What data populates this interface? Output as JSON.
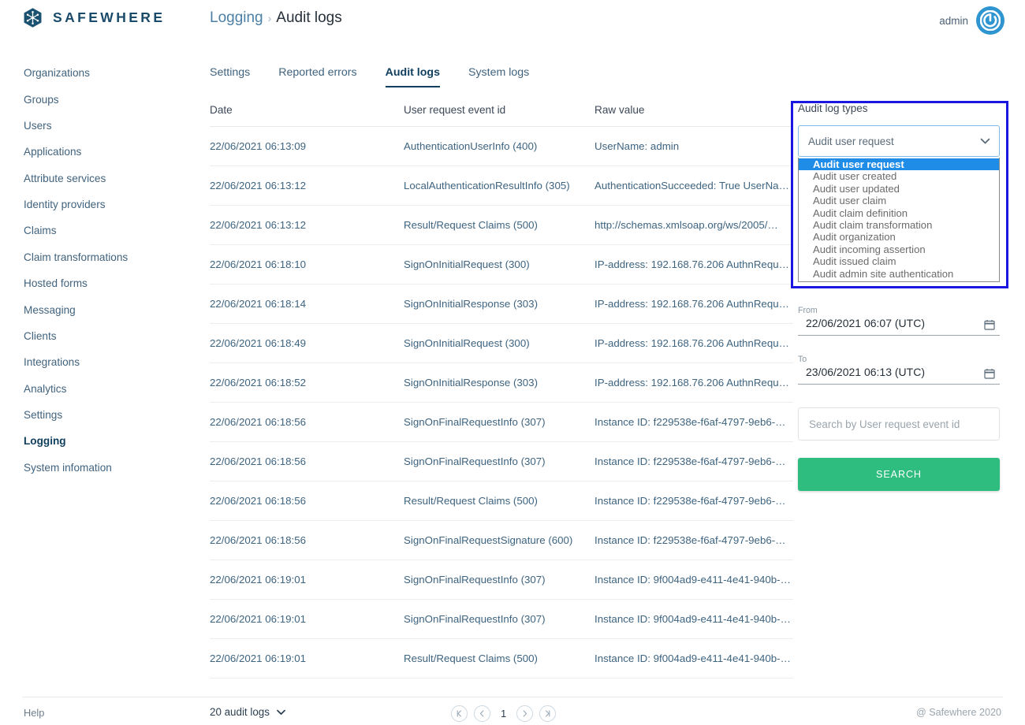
{
  "brand": {
    "name": "SAFEWHERE",
    "logo_icon": "snowflake-hex-logo"
  },
  "breadcrumb": {
    "parent": "Logging",
    "separator": "›",
    "current": "Audit logs"
  },
  "user": {
    "name": "admin",
    "avatar_icon": "power-icon"
  },
  "sidebar": {
    "items": [
      {
        "label": "Organizations",
        "active": false
      },
      {
        "label": "Groups",
        "active": false
      },
      {
        "label": "Users",
        "active": false
      },
      {
        "label": "Applications",
        "active": false
      },
      {
        "label": "Attribute services",
        "active": false
      },
      {
        "label": "Identity providers",
        "active": false
      },
      {
        "label": "Claims",
        "active": false
      },
      {
        "label": "Claim transformations",
        "active": false
      },
      {
        "label": "Hosted forms",
        "active": false
      },
      {
        "label": "Messaging",
        "active": false
      },
      {
        "label": "Clients",
        "active": false
      },
      {
        "label": "Integrations",
        "active": false
      },
      {
        "label": "Analytics",
        "active": false
      },
      {
        "label": "Settings",
        "active": false
      },
      {
        "label": "Logging",
        "active": true
      },
      {
        "label": "System infomation",
        "active": false
      }
    ]
  },
  "tabs": [
    {
      "label": "Settings",
      "active": false
    },
    {
      "label": "Reported errors",
      "active": false
    },
    {
      "label": "Audit logs",
      "active": true
    },
    {
      "label": "System logs",
      "active": false
    }
  ],
  "table": {
    "columns": [
      "Date",
      "User request event id",
      "Raw value"
    ],
    "rows": [
      {
        "date": "22/06/2021 06:13:09",
        "event": "AuthenticationUserInfo (400)",
        "raw": "UserName: admin"
      },
      {
        "date": "22/06/2021 06:13:12",
        "event": "LocalAuthenticationResultInfo (305)",
        "raw": "AuthenticationSucceeded: True UserNa…"
      },
      {
        "date": "22/06/2021 06:13:12",
        "event": "Result/Request Claims (500)",
        "raw": "http://schemas.xmlsoap.org/ws/2005/…"
      },
      {
        "date": "22/06/2021 06:18:10",
        "event": "SignOnInitialRequest (300)",
        "raw": "IP-address: 192.168.76.206 AuthnRequ…"
      },
      {
        "date": "22/06/2021 06:18:14",
        "event": "SignOnInitialResponse (303)",
        "raw": "IP-address: 192.168.76.206 AuthnRequ…"
      },
      {
        "date": "22/06/2021 06:18:49",
        "event": "SignOnInitialRequest (300)",
        "raw": "IP-address: 192.168.76.206 AuthnRequ…"
      },
      {
        "date": "22/06/2021 06:18:52",
        "event": "SignOnInitialResponse (303)",
        "raw": "IP-address: 192.168.76.206 AuthnRequ…"
      },
      {
        "date": "22/06/2021 06:18:56",
        "event": "SignOnFinalRequestInfo (307)",
        "raw": "Instance ID: f229538e-f6af-4797-9eb6-…"
      },
      {
        "date": "22/06/2021 06:18:56",
        "event": "SignOnFinalRequestInfo (307)",
        "raw": "Instance ID: f229538e-f6af-4797-9eb6-…"
      },
      {
        "date": "22/06/2021 06:18:56",
        "event": "Result/Request Claims (500)",
        "raw": "Instance ID: f229538e-f6af-4797-9eb6-…"
      },
      {
        "date": "22/06/2021 06:18:56",
        "event": "SignOnFinalRequestSignature (600)",
        "raw": "Instance ID: f229538e-f6af-4797-9eb6-…"
      },
      {
        "date": "22/06/2021 06:19:01",
        "event": "SignOnFinalRequestInfo (307)",
        "raw": "Instance ID: 9f004ad9-e411-4e41-940b-…"
      },
      {
        "date": "22/06/2021 06:19:01",
        "event": "SignOnFinalRequestInfo (307)",
        "raw": "Instance ID: 9f004ad9-e411-4e41-940b-…"
      },
      {
        "date": "22/06/2021 06:19:01",
        "event": "Result/Request Claims (500)",
        "raw": "Instance ID: 9f004ad9-e411-4e41-940b-…"
      }
    ]
  },
  "filter": {
    "panel_label": "Audit log types",
    "select_value": "Audit user request",
    "select_open": true,
    "options": [
      "Audit user request",
      "Audit user created",
      "Audit user updated",
      "Audit user claim",
      "Audit claim definition",
      "Audit claim transformation",
      "Audit organization",
      "Audit incoming assertion",
      "Audit issued claim",
      "Audit admin site authentication"
    ],
    "from_label": "From",
    "from_value": "22/06/2021 06:07 (UTC)",
    "to_label": "To",
    "to_value": "23/06/2021 06:13 (UTC)",
    "search_placeholder": "Search by User request event id",
    "search_value": "",
    "search_button": "SEARCH",
    "highlight_color": "#1f8ce8",
    "button_color": "#2ebd7e",
    "outline_color": "#1a17e0"
  },
  "footer": {
    "help": "Help",
    "count": "20 audit logs",
    "page": "1",
    "first_icon": "first-page-icon",
    "prev_icon": "previous-page-icon",
    "next_icon": "next-page-icon",
    "last_icon": "last-page-icon",
    "copyright": "@ Safewhere 2020"
  }
}
